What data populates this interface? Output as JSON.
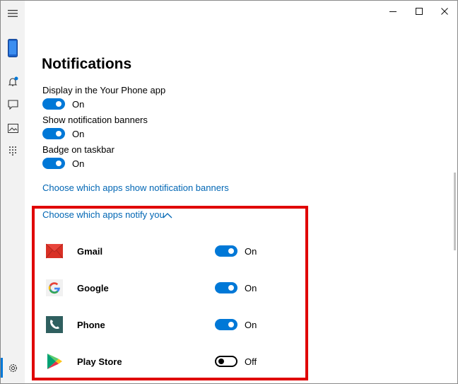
{
  "window": {
    "controls": [
      "minimize",
      "maximize",
      "close"
    ]
  },
  "sidebar": {
    "items": [
      {
        "icon": "menu-icon"
      },
      {
        "icon": "phone-icon"
      },
      {
        "icon": "notification-bell-icon",
        "badge": true
      },
      {
        "icon": "messages-icon"
      },
      {
        "icon": "photos-icon"
      },
      {
        "icon": "dialpad-icon"
      },
      {
        "icon": "settings-icon",
        "selected": true
      }
    ]
  },
  "page": {
    "title": "Notifications",
    "settings": [
      {
        "label": "Display in the Your Phone app",
        "state": "On"
      },
      {
        "label": "Show notification banners",
        "state": "On"
      },
      {
        "label": "Badge on taskbar",
        "state": "On"
      }
    ],
    "banner_link": "Choose which apps show notification banners",
    "apps_header": "Choose which apps notify you",
    "apps": [
      {
        "name": "Gmail",
        "state": "On",
        "color": "#d93025"
      },
      {
        "name": "Google",
        "state": "On",
        "color": "#4285f4"
      },
      {
        "name": "Phone",
        "state": "On",
        "color": "#2f5f5f"
      },
      {
        "name": "Play Store",
        "state": "Off",
        "color": "#00a173"
      }
    ]
  },
  "colors": {
    "accent": "#0078d7",
    "link": "#0066b4",
    "highlight": "#e00000"
  }
}
